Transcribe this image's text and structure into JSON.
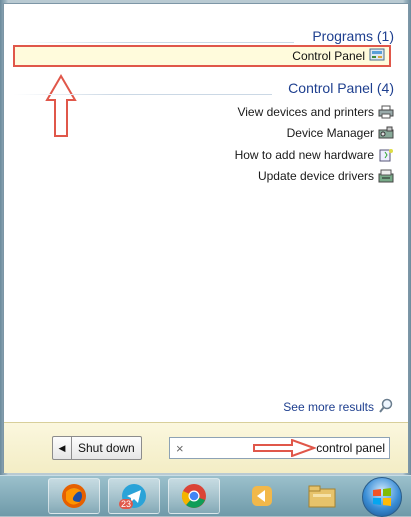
{
  "programs": {
    "header": "Programs (1)",
    "items": [
      {
        "label": "Control Panel",
        "icon": "control-panel-icon"
      }
    ]
  },
  "control_panel": {
    "header": "Control Panel (4)",
    "items": [
      {
        "label": "View devices and printers",
        "icon": "printer-icon"
      },
      {
        "label": "Device Manager",
        "icon": "device-manager-icon"
      },
      {
        "label": "How to add new hardware",
        "icon": "hardware-help-icon"
      },
      {
        "label": "Update device drivers",
        "icon": "driver-icon"
      }
    ]
  },
  "see_more": "See more results",
  "search": {
    "value": "control panel",
    "clear": "×"
  },
  "shutdown": {
    "label": "Shut down",
    "arrow": "◀"
  },
  "taskbar": {
    "items": [
      {
        "name": "firefox-icon"
      },
      {
        "name": "telegram-icon",
        "badge": "23"
      },
      {
        "name": "chrome-icon"
      },
      {
        "name": "media-player-icon"
      },
      {
        "name": "file-explorer-icon"
      }
    ]
  },
  "colors": {
    "accent": "#1e3f8f",
    "highlight_border": "#e0574a",
    "highlight_bg": "#fffbdc"
  }
}
